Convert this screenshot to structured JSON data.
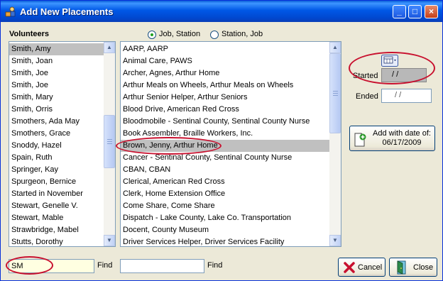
{
  "window": {
    "title": "Add New Placements"
  },
  "volunteers": {
    "label": "Volunteers",
    "items": [
      "Smith, Amy",
      "Smith, Joan",
      "Smith, Joe",
      "Smith, Joe",
      "Smith, Mary",
      "Smith, Orris",
      "Smothers, Ada May",
      "Smothers, Grace",
      "Snoddy, Hazel",
      "Spain, Ruth",
      "Springer, Kay",
      "Spurgeon, Bernice",
      "Started in November",
      "Stewart, Genelle V.",
      "Stewart, Mable",
      "Strawbridge, Mabel",
      "Stutts, Dorothy"
    ],
    "selected_index": 0,
    "find_value": "SM",
    "find_label": "Find"
  },
  "sort_options": [
    {
      "label": "Job, Station",
      "checked": true
    },
    {
      "label": "Station, Job",
      "checked": false
    }
  ],
  "jobs": {
    "items": [
      "AARP, AARP",
      "Animal Care, PAWS",
      "Archer, Agnes, Arthur Home",
      "Arthur Meals on Wheels, Arthur Meals on Wheels",
      "Arthur Senior Helper, Arthur Seniors",
      "Blood Drive, American Red Cross",
      "Bloodmobile - Sentinal County, Sentinal County Nurse",
      "Book Assembler, Braille Workers, Inc.",
      "Brown, Jenny, Arthur Home",
      "Cancer - Sentinal County, Sentinal County Nurse",
      "CBAN, CBAN",
      "Clerical, American Red Cross",
      "Clerk, Home Extension Office",
      "Come Share, Come Share",
      "Dispatch - Lake County, Lake Co. Transportation",
      "Docent, County Museum",
      "Driver Services Helper, Driver Services Facility"
    ],
    "selected_index": 8,
    "find_value": "",
    "find_label": "Find"
  },
  "dates": {
    "started_label": "Started",
    "started_value": " /   /",
    "ended_label": "Ended",
    "ended_value": "/   /"
  },
  "add_button": {
    "line1": "Add with date of:",
    "line2": "06/17/2009"
  },
  "cancel_label": "Cancel",
  "close_label": "Close",
  "icons": {
    "app": "app-icon",
    "calendar": "calendar-icon",
    "add": "add-placement-icon",
    "cancel": "red-x-icon",
    "close": "door-exit-icon"
  },
  "colors": {
    "highlight_oval": "#c8102e",
    "selected_row": "#c0c0c0",
    "find_field": "#ffffe1"
  }
}
